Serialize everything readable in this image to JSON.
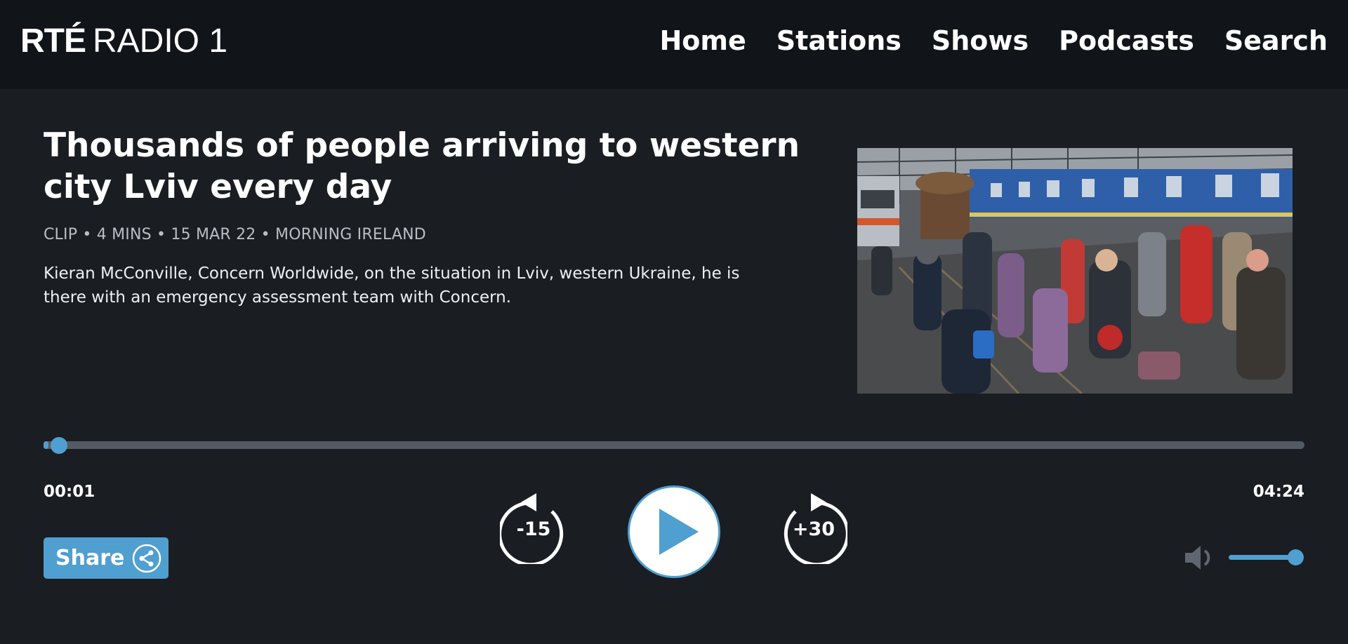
{
  "header": {
    "logo_rte": "RTÉ",
    "logo_station": "RADIO 1",
    "nav": [
      "Home",
      "Stations",
      "Shows",
      "Podcasts",
      "Search"
    ]
  },
  "episode": {
    "title": "Thousands of people arriving to western city Lviv every day",
    "meta": "CLIP • 4 MINS • 15 MAR 22 • MORNING IRELAND",
    "description": "Kieran McConville, Concern Worldwide, on the situation in Lviv, western Ukraine, he is there with an emergency assessment team with Concern."
  },
  "player": {
    "current_time": "00:01",
    "total_time": "04:24",
    "progress_fraction": 0.004,
    "skip_back_label": "-15",
    "skip_forward_label": "+30",
    "volume_fraction": 1.0,
    "share_label": "Share"
  },
  "colors": {
    "page_background": "#1a1d22",
    "header_background": "#111419",
    "accent": "#4f9fd0",
    "track": "#545a63",
    "meta_text": "#b9bec6"
  },
  "icons": {
    "play": "play-icon",
    "skip_back": "rewind-15-icon",
    "skip_forward": "forward-30-icon",
    "share": "share-icon",
    "volume": "volume-icon"
  }
}
